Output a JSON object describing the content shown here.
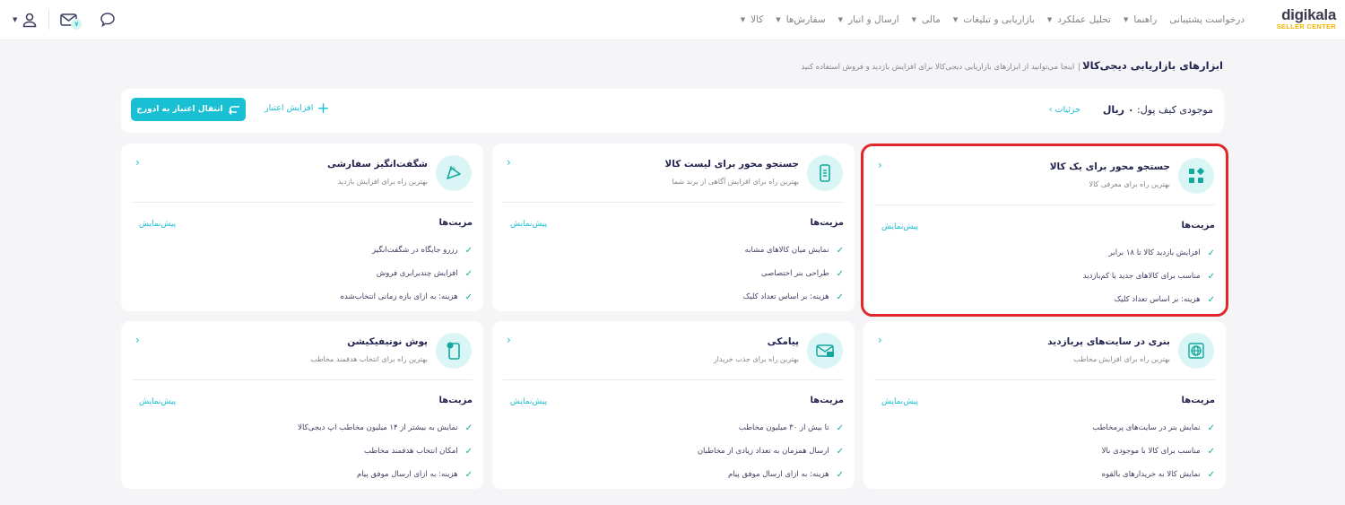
{
  "logo": {
    "name": "digikala",
    "sub": "SELLER CENTER"
  },
  "nav": [
    {
      "label": "کالا"
    },
    {
      "label": "سفارش‌ها"
    },
    {
      "label": "ارسال و انبار"
    },
    {
      "label": "مالی"
    },
    {
      "label": "بازاریابی و تبلیغات"
    },
    {
      "label": "تحلیل عملکرد"
    },
    {
      "label": "راهنما"
    },
    {
      "label": "درخواست پشتیبانی"
    }
  ],
  "topbar": {
    "message_count": "۷"
  },
  "header": {
    "title": "ابزارهای بازاریابی دیجی‌کالا",
    "separator": " | ",
    "subtitle": "اینجا می‌توانید از ابزارهای بازاریابی دیجی‌کالا برای افزایش بازدید و فروش استفاده کنید"
  },
  "wallet": {
    "label": "موجودی کیف پول:",
    "amount": "۰ ریال",
    "details": "جزئیات ›",
    "increase": "افزایش اعتبار",
    "transfer": "انتقال اعتبار به ادورج"
  },
  "cards": [
    {
      "title": "جستجو محور برای یک کالا",
      "subtitle": "بهترین راه برای معرفی کالا",
      "features_label": "مزیت‌ها",
      "preview": "پیش‌نمایش",
      "icon": "squares-icon",
      "items": [
        "افزایش بازدید کالا تا ۱۸ برابر",
        "مناسب برای کالاهای جدید یا کم‌بازدید",
        "هزینه: بر اساس تعداد کلیک"
      ]
    },
    {
      "title": "جستجو محور برای لیست کالا",
      "subtitle": "بهترین راه برای افزایش آگاهی از برند شما",
      "features_label": "مزیت‌ها",
      "preview": "پیش‌نمایش",
      "icon": "phone-list-icon",
      "items": [
        "نمایش میان کالاهای مشابه",
        "طراحی بنر اختصاصی",
        "هزینه: بر اساس تعداد کلیک"
      ]
    },
    {
      "title": "شگفت‌انگیز سفارشی",
      "subtitle": "بهترین راه برای افزایش بازدید",
      "features_label": "مزیت‌ها",
      "preview": "پیش‌نمایش",
      "icon": "discount-tag-icon",
      "items": [
        "رزرو جایگاه در شگفت‌انگیز",
        "افزایش چندبرابری فروش",
        "هزینه: به ازای بازه زمانی انتخاب‌شده"
      ]
    },
    {
      "title": "بنری در سایت‌های پربازدید",
      "subtitle": "بهترین راه برای افزایش مخاطب",
      "features_label": "مزیت‌ها",
      "preview": "پیش‌نمایش",
      "icon": "globe-icon",
      "items": [
        "نمایش بنر در سایت‌های پرمخاطب",
        "مناسب برای کالا با موجودی بالا",
        "نمایش کالا به خریدارهای بالقوه"
      ]
    },
    {
      "title": "پیامکی",
      "subtitle": "بهترین راه برای جذب خریدار",
      "features_label": "مزیت‌ها",
      "preview": "پیش‌نمایش",
      "icon": "sms-envelope-icon",
      "items": [
        "تا بیش از ۳۰ میلیون مخاطب",
        "ارسال همزمان به تعداد زیادی از مخاطبان",
        "هزینه: به ازای ارسال موفق پیام"
      ]
    },
    {
      "title": "پوش نوتیفیکیشن",
      "subtitle": "بهترین راه برای انتخاب هدفمند مخاطب",
      "features_label": "مزیت‌ها",
      "preview": "پیش‌نمایش",
      "icon": "phone-notification-icon",
      "items": [
        "نمایش به بیشتر از ۱۴ میلیون مخاطب اپ دیجی‌کالا",
        "امکان انتخاب هدفمند مخاطب",
        "هزینه: به ازای ارسال موفق پیام"
      ]
    }
  ],
  "colors": {
    "accent": "#19bfd3",
    "check": "#13a89e",
    "selection": "#e1262c",
    "icon_bg": "#d9f5f6",
    "text": "#23254e"
  }
}
